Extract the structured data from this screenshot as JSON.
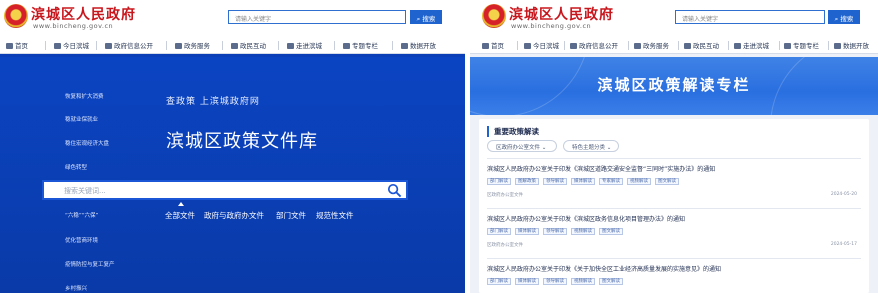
{
  "site": {
    "title": "滨城区人民政府",
    "domain": "www.bincheng.gov.cn",
    "search_placeholder": "请输入关键字",
    "search_button": "搜索"
  },
  "nav": [
    "首页",
    "今日滨城",
    "政府信息公开",
    "政务服务",
    "政民互动",
    "走进滨城",
    "专题专栏",
    "数据开放"
  ],
  "library": {
    "sidebar": [
      "恢复和扩大消费",
      "稳就业保就业",
      "稳住宏观经济大盘",
      "绿色转型",
      "“六稳”“六保”",
      "优化营商环境",
      "疫情防控与复工复产",
      "乡村振兴"
    ],
    "subtitle": "查政策 上滨城政府网",
    "title": "滨城区政策文件库",
    "search_placeholder": "搜索关键词...",
    "tabs": [
      "全部文件",
      "政府与政府办文件",
      "部门文件",
      "规范性文件"
    ]
  },
  "interpretation": {
    "banner_title": "滨城区政策解读专栏",
    "section_title": "重要政策解读",
    "filters": [
      "区政府办公室文件",
      "特色主题分类"
    ],
    "policies": [
      {
        "title": "滨城区人民政府办公室关于印发《滨城区道路交通安全监督“三同时”实施办法》的通知",
        "tags": [
          "部门解读",
          "图解政策",
          "领导解读",
          "媒体解读",
          "专家解读",
          "视频解读",
          "图文解读"
        ],
        "source": "区政府办公室文件",
        "date": "2024-05-20"
      },
      {
        "title": "滨城区人民政府办公室关于印发《滨城区政务信息化项目管理办法》的通知",
        "tags": [
          "部门解读",
          "媒体解读",
          "领导解读",
          "视频解读",
          "图文解读"
        ],
        "source": "区政府办公室文件",
        "date": "2024-05-17"
      },
      {
        "title": "滨城区人民政府办公室关于印发《关于加快全区工业经济高质量发展的实施意见》的通知",
        "tags": [
          "部门解读",
          "媒体解读",
          "领导解读",
          "视频解读",
          "图文解读"
        ],
        "source": "",
        "date": ""
      }
    ]
  },
  "colors": {
    "brand_red": "#c8161d",
    "library_blue": "#0a3fb8",
    "accent_blue": "#1f63cf",
    "banner_blue": "#2a6fe0"
  }
}
